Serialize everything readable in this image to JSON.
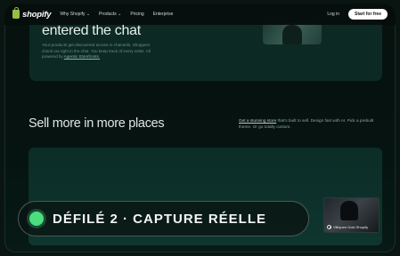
{
  "nav": {
    "brand": "shopify",
    "items": [
      {
        "label": "Why Shopify ⌄"
      },
      {
        "label": "Products ⌄"
      },
      {
        "label": "Pricing"
      },
      {
        "label": "Enterprise"
      }
    ],
    "login": "Log in",
    "cta": "Start for free"
  },
  "hero": {
    "title": "entered the chat",
    "body": "Your products get discovered across AI channels. Shoppers check out right in the chat. You keep track of every order. All powered by",
    "link": "Agentic Storefronts."
  },
  "section": {
    "title": "Sell more in more places",
    "link": "Get a stunning store",
    "desc": " that's built to sell. Design fast with AI. Pick a prebuilt theme. Or go totally custom."
  },
  "overlay": {
    "label": "DÉFILÉ 2 · CAPTURE RÉELLE"
  },
  "thumbnail": {
    "caption": "Villiquee Gold Shopify"
  },
  "colors": {
    "brand_green": "#95bf47",
    "status_dot": "#4ade80",
    "card": "#0c2a23"
  }
}
